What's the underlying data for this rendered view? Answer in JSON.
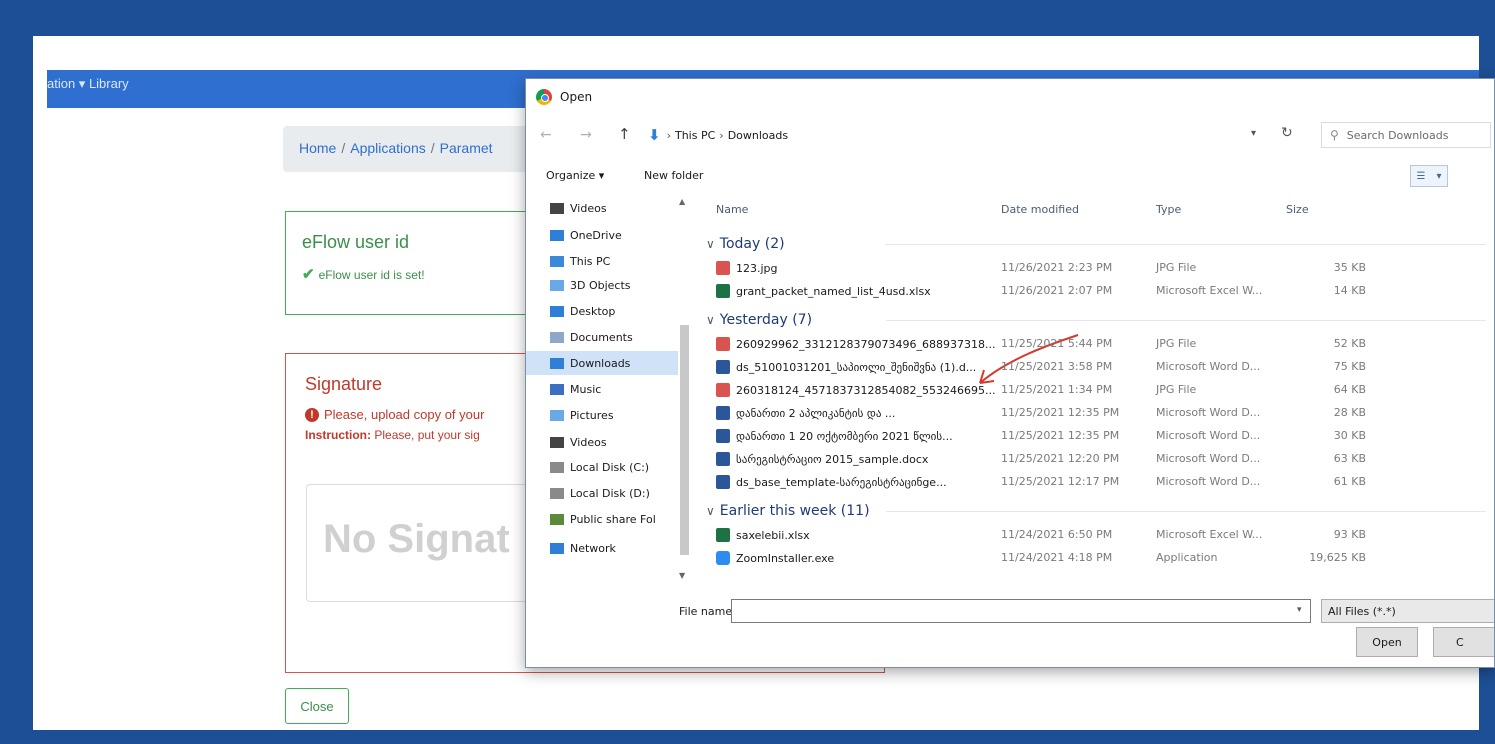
{
  "page": {
    "nav_text": "ation ▾  Library",
    "breadcrumb": [
      "Home",
      "Applications",
      "Paramet"
    ],
    "user_card": {
      "title": "eFlow user id",
      "status": "eFlow user id is set!"
    },
    "signature_card": {
      "title": "Signature",
      "warning": "Please, upload copy of your",
      "instruction_label": "Instruction:",
      "instruction_text": "Please, put your sig",
      "placeholder": "No Signat"
    },
    "close_label": "Close"
  },
  "dialog": {
    "title": "Open",
    "path": [
      "This PC",
      "Downloads"
    ],
    "search_placeholder": "Search Downloads",
    "toolbar": {
      "organize": "Organize ▾",
      "new_folder": "New folder"
    },
    "nav_items": [
      {
        "label": "Videos",
        "icon": "video-folder-icon"
      },
      {
        "label": "OneDrive",
        "icon": "cloud-icon"
      },
      {
        "label": "This PC",
        "icon": "computer-icon"
      },
      {
        "label": "3D Objects",
        "icon": "cube-folder-icon"
      },
      {
        "label": "Desktop",
        "icon": "desktop-folder-icon"
      },
      {
        "label": "Documents",
        "icon": "documents-folder-icon"
      },
      {
        "label": "Downloads",
        "icon": "download-folder-icon",
        "selected": true
      },
      {
        "label": "Music",
        "icon": "music-folder-icon"
      },
      {
        "label": "Pictures",
        "icon": "pictures-folder-icon"
      },
      {
        "label": "Videos",
        "icon": "video-folder-icon"
      },
      {
        "label": "Local Disk (C:)",
        "icon": "drive-icon"
      },
      {
        "label": "Local Disk (D:)",
        "icon": "drive-icon"
      },
      {
        "label": "Public share Fol",
        "icon": "network-drive-icon"
      },
      {
        "label": "Network",
        "icon": "network-icon"
      }
    ],
    "columns": {
      "name": "Name",
      "date": "Date modified",
      "type": "Type",
      "size": "Size"
    },
    "groups": [
      {
        "label": "Today (2)",
        "files": [
          {
            "name": "123.jpg",
            "date": "11/26/2021 2:23 PM",
            "type": "JPG File",
            "size": "35 KB",
            "kind": "jpg"
          },
          {
            "name": "grant_packet_named_list_4usd.xlsx",
            "date": "11/26/2021 2:07 PM",
            "type": "Microsoft Excel W...",
            "size": "14 KB",
            "kind": "xls"
          }
        ]
      },
      {
        "label": "Yesterday (7)",
        "files": [
          {
            "name": "260929962_3312128379073496_688937318...",
            "date": "11/25/2021 5:44 PM",
            "type": "JPG File",
            "size": "52 KB",
            "kind": "jpg"
          },
          {
            "name": "ds_51001031201_საპიოლი_შენიშვნა (1).d...",
            "date": "11/25/2021 3:58 PM",
            "type": "Microsoft Word D...",
            "size": "75 KB",
            "kind": "doc"
          },
          {
            "name": "260318124_4571837312854082_553246695...",
            "date": "11/25/2021 1:34 PM",
            "type": "JPG File",
            "size": "64 KB",
            "kind": "jpg"
          },
          {
            "name": "დანართი 2 აპლიკანტის და ...",
            "date": "11/25/2021 12:35 PM",
            "type": "Microsoft Word D...",
            "size": "28 KB",
            "kind": "doc"
          },
          {
            "name": "დანართი 1 20 ოქტომბერი 2021 წლის...",
            "date": "11/25/2021 12:35 PM",
            "type": "Microsoft Word D...",
            "size": "30 KB",
            "kind": "doc"
          },
          {
            "name": "სარეგისტრაციო 2015_sample.docx",
            "date": "11/25/2021 12:20 PM",
            "type": "Microsoft Word D...",
            "size": "63 KB",
            "kind": "doc"
          },
          {
            "name": "ds_base_template-სარეგისტრაცინge...",
            "date": "11/25/2021 12:17 PM",
            "type": "Microsoft Word D...",
            "size": "61 KB",
            "kind": "doc"
          }
        ]
      },
      {
        "label": "Earlier this week (11)",
        "files": [
          {
            "name": "saxelebii.xlsx",
            "date": "11/24/2021 6:50 PM",
            "type": "Microsoft Excel W...",
            "size": "93 KB",
            "kind": "xls"
          },
          {
            "name": "ZoomInstaller.exe",
            "date": "11/24/2021 4:18 PM",
            "type": "Application",
            "size": "19,625 KB",
            "kind": "exe"
          }
        ]
      }
    ],
    "file_name_label": "File name:",
    "file_name_value": "",
    "filter": "All Files (*.*)",
    "open_label": "Open",
    "cancel_label": "C"
  }
}
